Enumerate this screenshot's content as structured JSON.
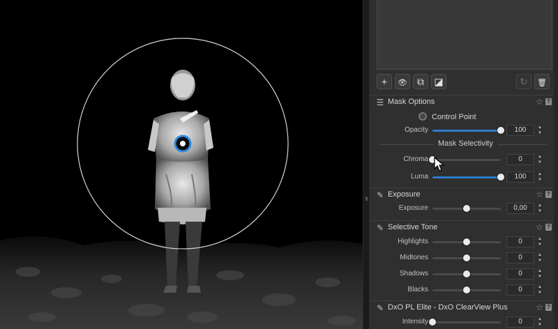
{
  "viewer": {
    "description_icon": "photo-canvas"
  },
  "toolbar": {
    "buttons": [
      {
        "name": "add-mask-button",
        "glyph": "+"
      },
      {
        "name": "show-mask-button",
        "glyph": "👁"
      },
      {
        "name": "duplicate-mask-button",
        "glyph": "⧉"
      },
      {
        "name": "invert-mask-button",
        "glyph": "◪"
      },
      {
        "name": "reset-mask-button",
        "glyph": "↻"
      },
      {
        "name": "delete-mask-button",
        "glyph": "🗑"
      }
    ]
  },
  "mask_options": {
    "title": "Mask Options",
    "control_point_label": "Control Point",
    "opacity": {
      "label": "Opacity",
      "value": "100",
      "level": 100
    },
    "selectivity_title": "Mask Selectivity",
    "chroma": {
      "label": "Chroma",
      "value": "0",
      "level": 0
    },
    "luma": {
      "label": "Luma",
      "value": "100",
      "level": 100
    }
  },
  "exposure": {
    "title": "Exposure",
    "exposure": {
      "label": "Exposure",
      "value": "0,00",
      "level": 50
    }
  },
  "selective_tone": {
    "title": "Selective Tone",
    "highlights": {
      "label": "Highlights",
      "value": "0",
      "level": 50
    },
    "midtones": {
      "label": "Midtones",
      "value": "0",
      "level": 50
    },
    "shadows": {
      "label": "Shadows",
      "value": "0",
      "level": 50
    },
    "blacks": {
      "label": "Blacks",
      "value": "0",
      "level": 50
    }
  },
  "clearview": {
    "title": "DxO PL Elite - DxO ClearView Plus",
    "intensity": {
      "label": "Intensity",
      "value": "0",
      "level": 0
    }
  },
  "common": {
    "star": "☆",
    "help": "?",
    "step_up": "▲",
    "step_down": "▼"
  },
  "colors": {
    "accent": "#2b7cc9",
    "panel_bg": "#2f2f2f",
    "viewer_bg": "#000000"
  }
}
